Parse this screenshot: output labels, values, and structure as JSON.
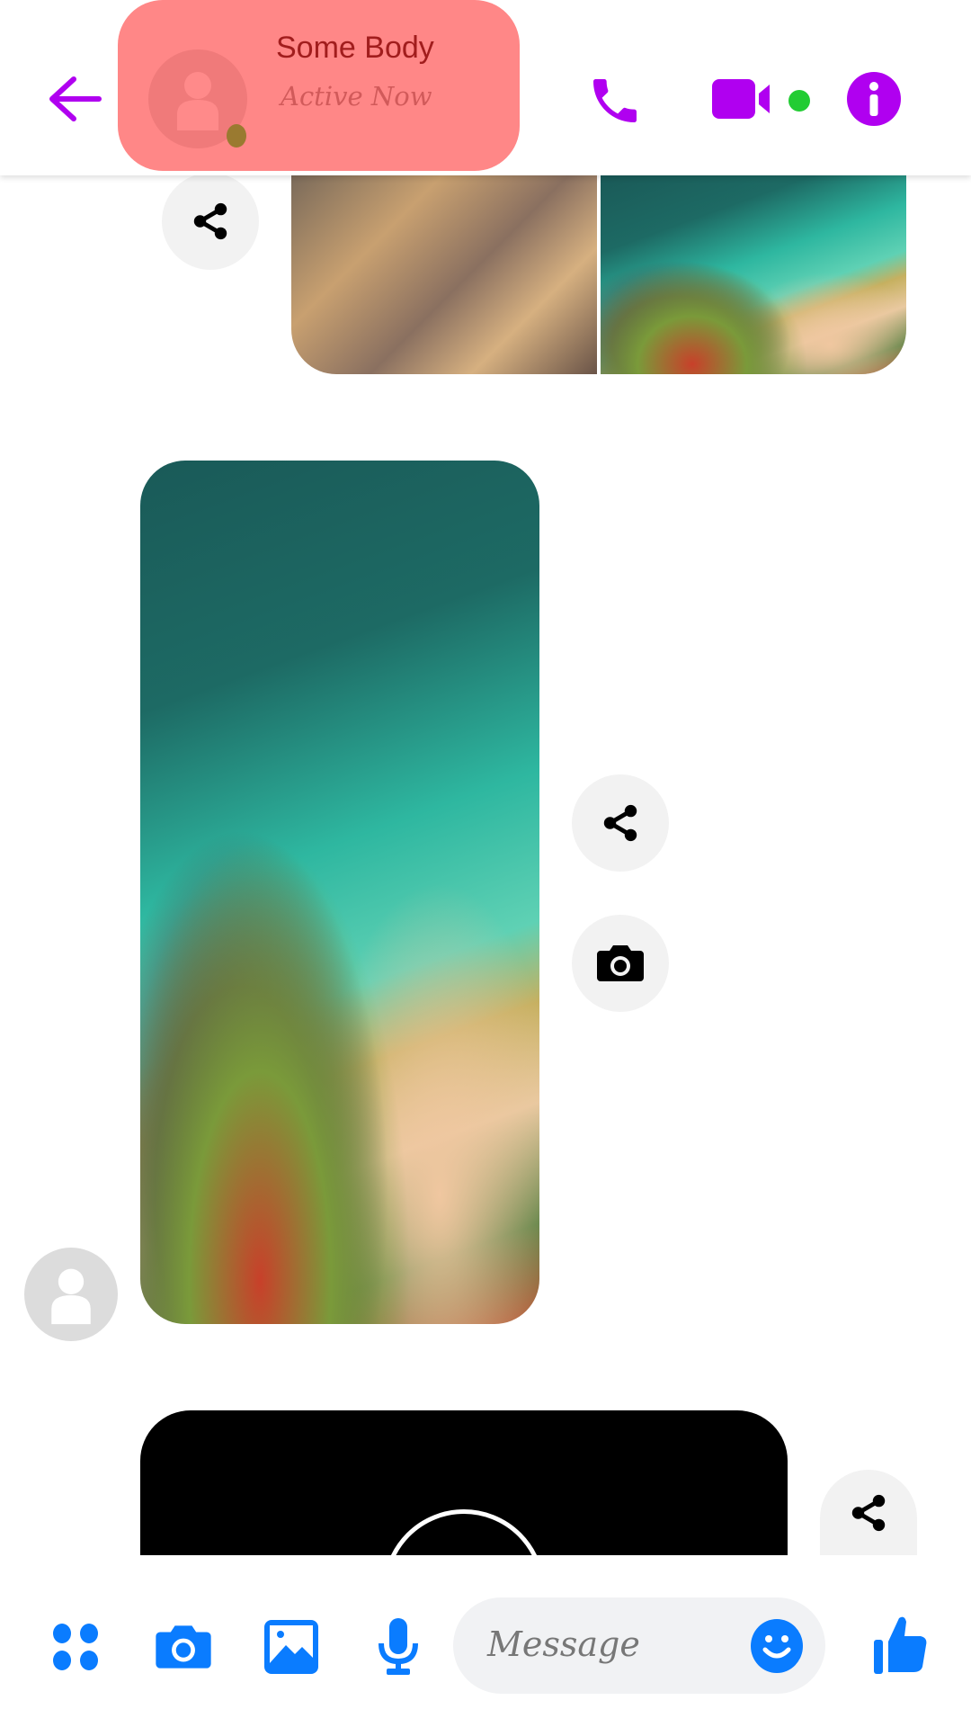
{
  "header": {
    "contact_name": "Some Body",
    "status": "Active Now",
    "icons": [
      "back-arrow-icon",
      "avatar-icon",
      "phone-icon",
      "video-icon",
      "info-icon"
    ],
    "accent_color": "#b000f0",
    "online_color": "#22cc33"
  },
  "messages": {
    "actions": [
      "share-icon",
      "camera-icon"
    ]
  },
  "composer": {
    "placeholder": "Message",
    "icons": [
      "apps-icon",
      "camera-icon",
      "image-icon",
      "mic-icon",
      "emoji-icon",
      "thumbs-up-icon"
    ],
    "accent_color": "#0a7cff"
  }
}
